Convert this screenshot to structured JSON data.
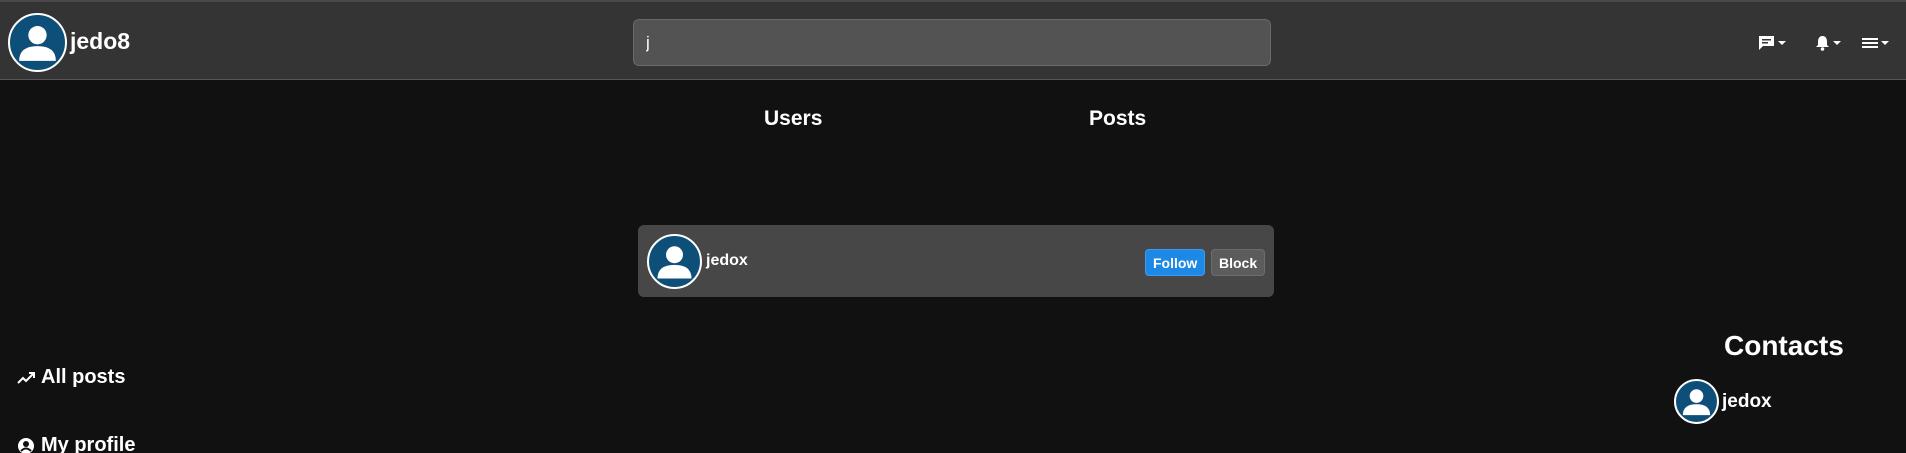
{
  "header": {
    "username": "jedo8",
    "search_value": "j",
    "icons": [
      "chat-icon",
      "bell-icon",
      "menu-icon"
    ]
  },
  "tabs": [
    {
      "label": "Users"
    },
    {
      "label": "Posts"
    }
  ],
  "results": [
    {
      "name": "jedox",
      "follow_label": "Follow",
      "block_label": "Block"
    }
  ],
  "sidebar": {
    "items": [
      {
        "label": "All posts",
        "icon": "trending-icon"
      },
      {
        "label": "My profile",
        "icon": "user-circle-icon"
      }
    ]
  },
  "contacts": {
    "title": "Contacts",
    "items": [
      {
        "name": "jedox"
      }
    ]
  },
  "colors": {
    "background": "#111111",
    "topbar": "#343434",
    "card": "#474747",
    "avatar": "#0d4f78",
    "follow": "#1e88e5"
  }
}
